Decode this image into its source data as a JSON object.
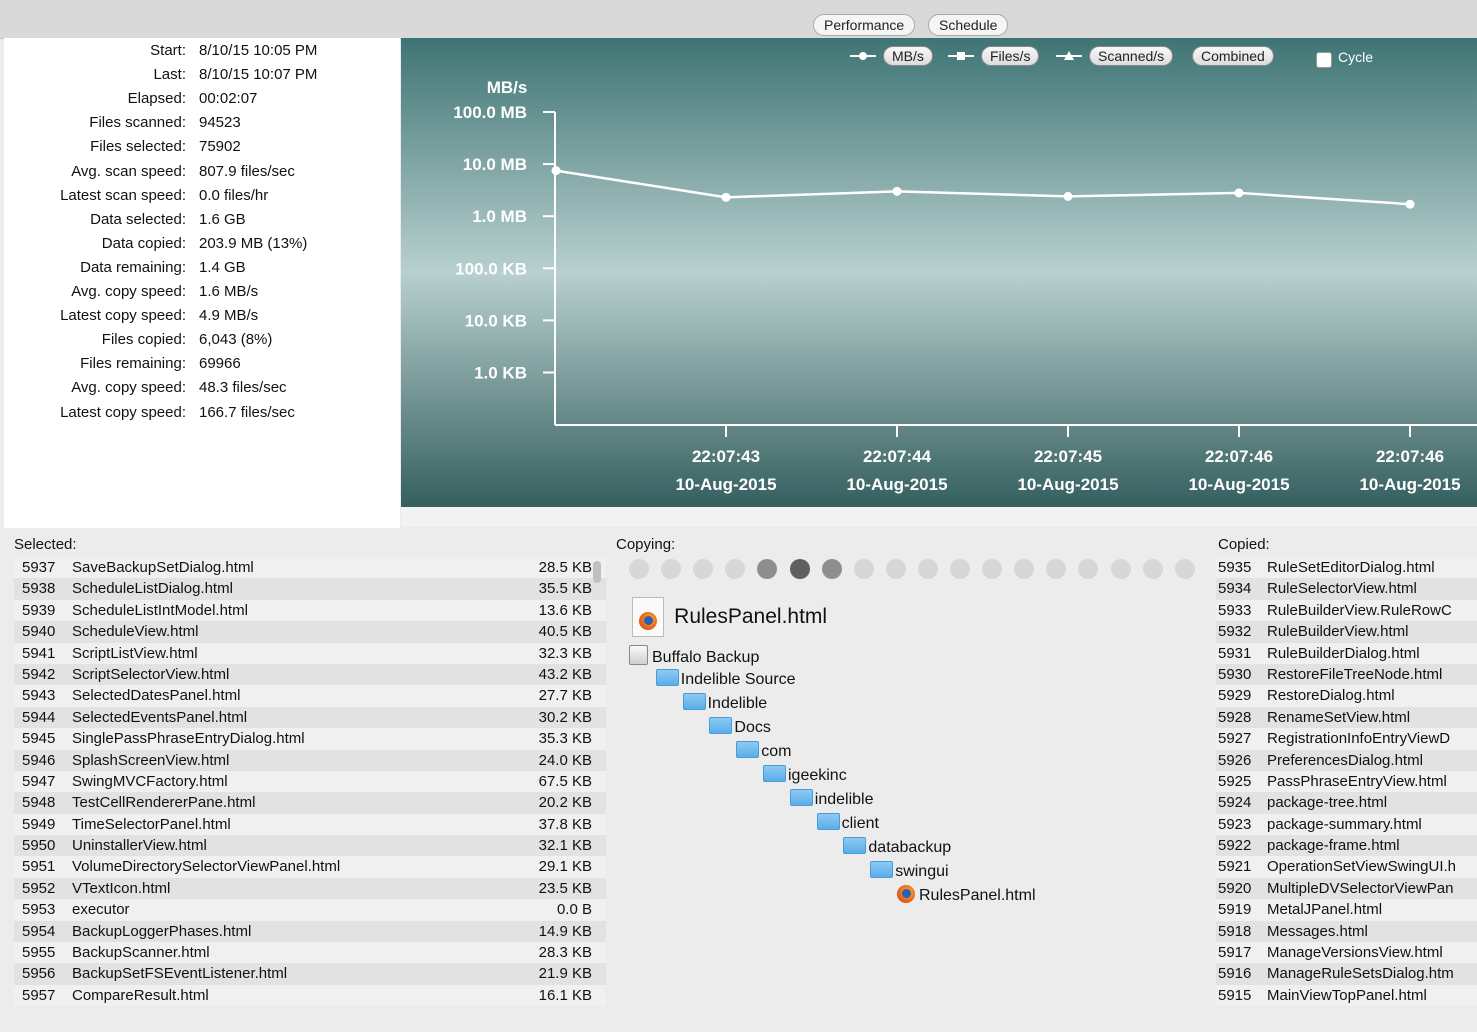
{
  "toolbar": {
    "tabs": [
      "Performance",
      "Schedule"
    ]
  },
  "stats": [
    {
      "label": "Start:",
      "value": "8/10/15 10:05 PM"
    },
    {
      "label": "Last:",
      "value": "8/10/15 10:07 PM"
    },
    {
      "label": "Elapsed:",
      "value": "00:02:07"
    },
    {
      "label": "Files scanned:",
      "value": "94523"
    },
    {
      "label": "Files selected:",
      "value": "75902"
    },
    {
      "label": "Avg. scan speed:",
      "value": "807.9 files/sec"
    },
    {
      "label": "Latest scan speed:",
      "value": "0.0 files/hr"
    },
    {
      "label": "Data selected:",
      "value": "1.6 GB"
    },
    {
      "label": "Data copied:",
      "value": "203.9 MB (13%)"
    },
    {
      "label": "Data remaining:",
      "value": "1.4 GB"
    },
    {
      "label": "Avg. copy speed:",
      "value": "1.6 MB/s"
    },
    {
      "label": "Latest copy speed:",
      "value": "4.9 MB/s"
    },
    {
      "label": "Files copied:",
      "value": "6,043 (8%)"
    },
    {
      "label": "Files remaining:",
      "value": "69966"
    },
    {
      "label": "Avg. copy speed:",
      "value": "48.3 files/sec"
    },
    {
      "label": "Latest copy speed:",
      "value": "166.7 files/sec"
    }
  ],
  "chart_controls": {
    "series_buttons": [
      "MB/s",
      "Files/s",
      "Scanned/s",
      "Combined"
    ],
    "cycle_label": "Cycle",
    "cycle_checked": false
  },
  "chart_data": {
    "type": "line",
    "ylabel": "MB/s",
    "yscale": "log",
    "ytick_labels": [
      "100.0 MB",
      "10.0 MB",
      "1.0 MB",
      "100.0 KB",
      "10.0 KB",
      "1.0 KB"
    ],
    "ytick_values_mb": [
      100,
      10,
      1,
      0.1,
      0.01,
      0.001
    ],
    "x_time": [
      "22:07:43",
      "22:07:44",
      "22:07:45",
      "22:07:46",
      "22:07:46"
    ],
    "x_date": [
      "10-Aug-2015",
      "10-Aug-2015",
      "10-Aug-2015",
      "10-Aug-2015",
      "10-Aug-2015"
    ],
    "series": [
      {
        "values_mb": [
          7.5,
          2.3,
          3.0,
          2.4,
          2.8,
          1.7
        ]
      }
    ],
    "grid": false,
    "colors": {
      "line": "#ffffff",
      "bg_top": "#3f7474",
      "bg_mid": "#b8d0cf",
      "bg_bottom": "#355f5f"
    }
  },
  "selected": {
    "title": "Selected:",
    "rows": [
      {
        "id": "5937",
        "name": "SaveBackupSetDialog.html",
        "size": "28.5 KB"
      },
      {
        "id": "5938",
        "name": "ScheduleListDialog.html",
        "size": "35.5 KB"
      },
      {
        "id": "5939",
        "name": "ScheduleListIntModel.html",
        "size": "13.6 KB"
      },
      {
        "id": "5940",
        "name": "ScheduleView.html",
        "size": "40.5 KB"
      },
      {
        "id": "5941",
        "name": "ScriptListView.html",
        "size": "32.3 KB"
      },
      {
        "id": "5942",
        "name": "ScriptSelectorView.html",
        "size": "43.2 KB"
      },
      {
        "id": "5943",
        "name": "SelectedDatesPanel.html",
        "size": "27.7 KB"
      },
      {
        "id": "5944",
        "name": "SelectedEventsPanel.html",
        "size": "30.2 KB"
      },
      {
        "id": "5945",
        "name": "SinglePassPhraseEntryDialog.html",
        "size": "35.3 KB"
      },
      {
        "id": "5946",
        "name": "SplashScreenView.html",
        "size": "24.0 KB"
      },
      {
        "id": "5947",
        "name": "SwingMVCFactory.html",
        "size": "67.5 KB"
      },
      {
        "id": "5948",
        "name": "TestCellRendererPane.html",
        "size": "20.2 KB"
      },
      {
        "id": "5949",
        "name": "TimeSelectorPanel.html",
        "size": "37.8 KB"
      },
      {
        "id": "5950",
        "name": "UninstallerView.html",
        "size": "32.1 KB"
      },
      {
        "id": "5951",
        "name": "VolumeDirectorySelectorViewPanel.html",
        "size": "29.1 KB"
      },
      {
        "id": "5952",
        "name": "VTextIcon.html",
        "size": "23.5 KB"
      },
      {
        "id": "5953",
        "name": "executor",
        "size": "0.0 B"
      },
      {
        "id": "5954",
        "name": "BackupLoggerPhases.html",
        "size": "14.9 KB"
      },
      {
        "id": "5955",
        "name": "BackupScanner.html",
        "size": "28.3 KB"
      },
      {
        "id": "5956",
        "name": "BackupSetFSEventListener.html",
        "size": "21.9 KB"
      },
      {
        "id": "5957",
        "name": "CompareResult.html",
        "size": "16.1 KB"
      }
    ]
  },
  "copying": {
    "title": "Copying:",
    "dots_total": 18,
    "dots_active": [
      4,
      5,
      6
    ],
    "dots_darkest": 5,
    "file_name": "RulesPanel.html",
    "path": [
      "Buffalo Backup",
      "Indelible Source",
      "Indelible",
      "Docs",
      "com",
      "igeekinc",
      "indelible",
      "client",
      "databackup",
      "swingui",
      "RulesPanel.html"
    ]
  },
  "copied": {
    "title": "Copied:",
    "rows": [
      {
        "id": "5935",
        "name": "RuleSetEditorDialog.html"
      },
      {
        "id": "5934",
        "name": "RuleSelectorView.html"
      },
      {
        "id": "5933",
        "name": "RuleBuilderView.RuleRowC"
      },
      {
        "id": "5932",
        "name": "RuleBuilderView.html"
      },
      {
        "id": "5931",
        "name": "RuleBuilderDialog.html"
      },
      {
        "id": "5930",
        "name": "RestoreFileTreeNode.html"
      },
      {
        "id": "5929",
        "name": "RestoreDialog.html"
      },
      {
        "id": "5928",
        "name": "RenameSetView.html"
      },
      {
        "id": "5927",
        "name": "RegistrationInfoEntryViewD"
      },
      {
        "id": "5926",
        "name": "PreferencesDialog.html"
      },
      {
        "id": "5925",
        "name": "PassPhraseEntryView.html"
      },
      {
        "id": "5924",
        "name": "package-tree.html"
      },
      {
        "id": "5923",
        "name": "package-summary.html"
      },
      {
        "id": "5922",
        "name": "package-frame.html"
      },
      {
        "id": "5921",
        "name": "OperationSetViewSwingUI.h"
      },
      {
        "id": "5920",
        "name": "MultipleDVSelectorViewPan"
      },
      {
        "id": "5919",
        "name": "MetalJPanel.html"
      },
      {
        "id": "5918",
        "name": "Messages.html"
      },
      {
        "id": "5917",
        "name": "ManageVersionsView.html"
      },
      {
        "id": "5916",
        "name": "ManageRuleSetsDialog.htm"
      },
      {
        "id": "5915",
        "name": "MainViewTopPanel.html"
      }
    ]
  }
}
